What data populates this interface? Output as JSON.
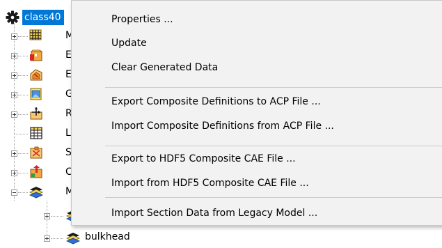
{
  "tree": {
    "root_label": "class40",
    "root_icon": "gear-icon",
    "nodes": [
      {
        "label": "M",
        "icon": "mesh-icon",
        "expander": "plus"
      },
      {
        "label": "E",
        "icon": "element-sets-icon",
        "expander": "plus"
      },
      {
        "label": "E",
        "icon": "edge-sets-icon",
        "expander": "plus"
      },
      {
        "label": "G",
        "icon": "geometry-icon",
        "expander": "plus"
      },
      {
        "label": "R",
        "icon": "rosettes-icon",
        "expander": "plus"
      },
      {
        "label": "L",
        "icon": "lookup-table-icon",
        "expander": "none"
      },
      {
        "label": "S",
        "icon": "selection-rules-icon",
        "expander": "plus"
      },
      {
        "label": "C",
        "icon": "oriented-sets-icon",
        "expander": "plus"
      },
      {
        "label": "M",
        "icon": "modeling-groups-icon",
        "expander": "minus"
      }
    ],
    "children": [
      {
        "label": "",
        "icon": "layer-stack-icon",
        "expander": "plus"
      },
      {
        "label": "bulkhead",
        "icon": "layer-stack-icon",
        "expander": "plus"
      }
    ]
  },
  "context_menu": {
    "groups": [
      [
        "Properties ...",
        "Update",
        "Clear Generated Data"
      ],
      [
        "Export Composite Definitions to ACP File ...",
        "Import Composite Definitions from ACP File ..."
      ],
      [
        "Export to HDF5 Composite CAE File ...",
        "Import from HDF5 Composite CAE File ..."
      ],
      [
        "Import Section Data from Legacy Model ..."
      ]
    ]
  },
  "colors": {
    "selection": "#0078d7",
    "menu_background": "#f2f2f2",
    "separator": "#cccccc"
  }
}
